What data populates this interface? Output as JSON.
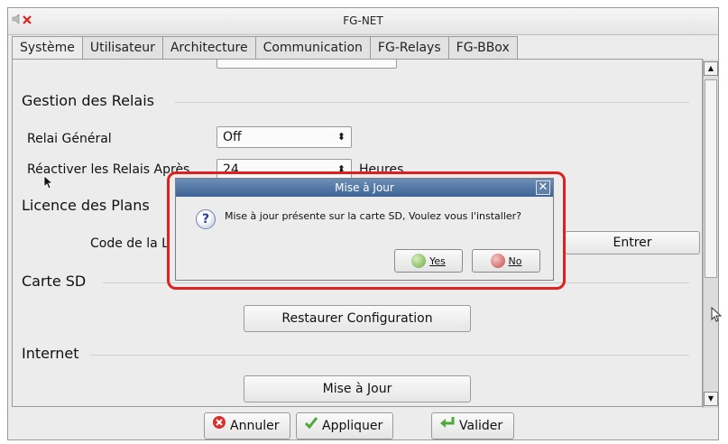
{
  "window": {
    "title": "FG-NET"
  },
  "tabs": [
    "Système",
    "Utilisateur",
    "Architecture",
    "Communication",
    "FG-Relays",
    "FG-BBox"
  ],
  "relais": {
    "section_title": "Gestion des Relais",
    "general_label": "Relai Général",
    "general_value": "Off",
    "reactivate_label": "Réactiver les Relais Après",
    "reactivate_value": "24",
    "reactivate_unit": "Heures"
  },
  "licence": {
    "section_title": "Licence des Plans",
    "code_label": "Code de la L",
    "enter_button": "Entrer"
  },
  "sd": {
    "section_title": "Carte SD",
    "restore_button": "Restaurer Configuration"
  },
  "internet": {
    "section_title": "Internet",
    "update_button": "Mise à Jour"
  },
  "bottom": {
    "cancel": "Annuler",
    "apply": "Appliquer",
    "validate": "Valider"
  },
  "dialog": {
    "title": "Mise à Jour",
    "message": "Mise à jour présente sur la carte SD, Voulez vous l'installer?",
    "yes": "Yes",
    "no": "No",
    "close_glyph": "✕"
  },
  "colors": {
    "highlight": "#e01f1f",
    "dialog_title": "#4a70a0"
  }
}
